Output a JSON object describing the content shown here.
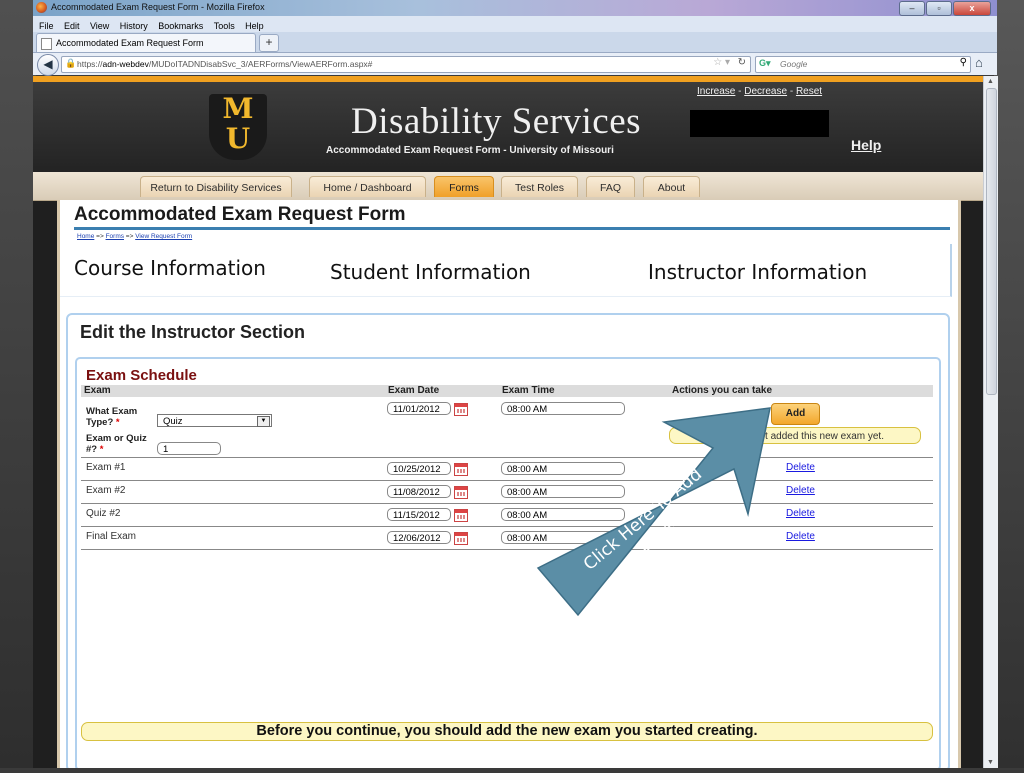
{
  "window": {
    "title": "Accommodated Exam Request Form - Mozilla Firefox",
    "buttons": [
      "–",
      "▫",
      "x"
    ]
  },
  "menubar": {
    "items": [
      "File",
      "Edit",
      "View",
      "History",
      "Bookmarks",
      "Tools",
      "Help"
    ]
  },
  "tabbar": {
    "tab_title": "Accommodated Exam Request Form",
    "new_tab": "+"
  },
  "navbar": {
    "url_prefix": "https://",
    "url_host": "adn-webdev",
    "url_path": "/MUDoITADNDisabSvc_3/AERForms/ViewAERForm.aspx#",
    "search_placeholder": "Google",
    "search_engine_icon": "google-g",
    "back_icon": "back-arrow",
    "home_icon": "home"
  },
  "header": {
    "logo_letters": {
      "top": "M",
      "bottom": "U"
    },
    "title": "Disability Services",
    "subtitle": "Accommodated Exam Request Form - University of Missouri",
    "size_increase": "Increase",
    "size_decrease": "Decrease",
    "size_reset": "Reset",
    "help": "Help"
  },
  "nav": {
    "tabs": [
      "Return to Disability Services",
      "Home / Dashboard",
      "Forms",
      "Test Roles",
      "FAQ",
      "About"
    ],
    "active": "Forms"
  },
  "page": {
    "title": "Accommodated Exam Request Form",
    "breadcrumb": [
      "Home",
      "Forms",
      "View Request Form"
    ],
    "breadcrumb_sep": "=>"
  },
  "info_tabs": [
    "Course Information",
    "Student Information",
    "Instructor Information"
  ],
  "edit_section": {
    "title": "Edit the Instructor Section",
    "schedule": {
      "title": "Exam Schedule",
      "columns": [
        "Exam",
        "Exam Date",
        "Exam Time",
        "Actions you can take"
      ],
      "new_exam": {
        "type_label": "What Exam Type?",
        "type_value": "Quiz",
        "number_label": "Exam or Quiz #?",
        "number_value": "1",
        "required_mark": "*",
        "date": "11/01/2012",
        "time": "08:00 AM",
        "add_label": "Add",
        "warning": "You have not added this new exam yet."
      },
      "rows": [
        {
          "name": "Exam #1",
          "date": "10/25/2012",
          "time": "08:00 AM",
          "action": "Delete"
        },
        {
          "name": "Exam #2",
          "date": "11/08/2012",
          "time": "08:00 AM",
          "action": "Delete"
        },
        {
          "name": "Quiz #2",
          "date": "11/15/2012",
          "time": "08:00 AM",
          "action": "Delete"
        },
        {
          "name": "Final Exam",
          "date": "12/06/2012",
          "time": "08:00 AM",
          "action": "Delete"
        }
      ],
      "bottom_notice": "Before you continue, you should add the new exam you started creating."
    }
  },
  "annotation": {
    "text_line1": "Click Here To Add",
    "text_line2": "Date",
    "color": "#5b8ea6"
  },
  "colors": {
    "accent_orange": "#f0a020",
    "header_dark": "#2b2b2b",
    "link_blue": "#1a1ae0",
    "section_red": "#7a1010",
    "border_blue": "#b0d0ee"
  }
}
